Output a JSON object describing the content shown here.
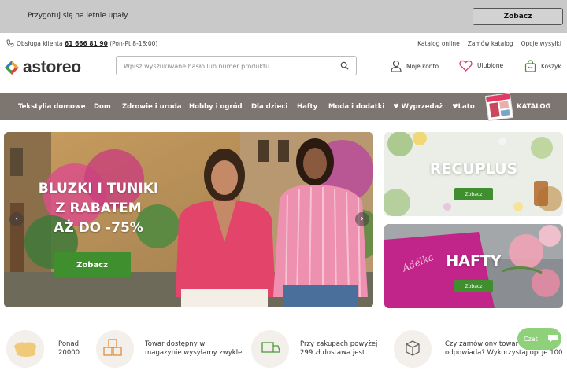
{
  "promo": {
    "text": "Przygotuj się na letnie upały",
    "button": "Zobacz"
  },
  "util": {
    "phone_label": "Obsługa klienta",
    "phone_number": "61 666 81 90",
    "phone_hours": "(Pon-Pt 8-18:00)",
    "links": [
      "Katalog online",
      "Zamów katalog",
      "Opcje wysyłki"
    ]
  },
  "header": {
    "logo": "astoreo",
    "search_placeholder": "Wpisz wyszukiwane hasło lub numer produktu",
    "account": "Moje konto",
    "favorites": "Ulubione",
    "cart": "Koszyk"
  },
  "nav": {
    "items": [
      "Tekstylia domowe",
      "Dom",
      "Zdrowie i uroda",
      "Hobby i ogród",
      "Dla dzieci",
      "Hafty",
      "Moda i dodatki",
      "♥ Wyprzedaż",
      "♥Lato"
    ],
    "catalog": "KATALOG"
  },
  "hero": {
    "line1": "BLUZKI I TUNIKI",
    "line2": "Z RABATEM",
    "line3": "AŻ DO -75%",
    "button": "Zobacz",
    "prev": "‹",
    "next": "›"
  },
  "side_banners": [
    {
      "title": "RECUPLUS",
      "button": "Zobacz"
    },
    {
      "title": "HAFTY",
      "button": "Zobacz",
      "script": "Adélka"
    }
  ],
  "features": [
    {
      "text": "Ponad\n20000"
    },
    {
      "text": "Towar dostępny w\nmagazynie wysyłamy zwykle"
    },
    {
      "text": "Przy zakupach powyżej\n299 zł dostawa jest"
    },
    {
      "text": "Czy zamówiony towar Ci nie\nodpowiada? Wykorzystaj opcje 100"
    }
  ],
  "chat": {
    "label": "Czat"
  },
  "colors": {
    "nav_bg": "#7c7570",
    "accent_green": "#3f8f2e",
    "promo_bg": "#c9c9c9"
  }
}
